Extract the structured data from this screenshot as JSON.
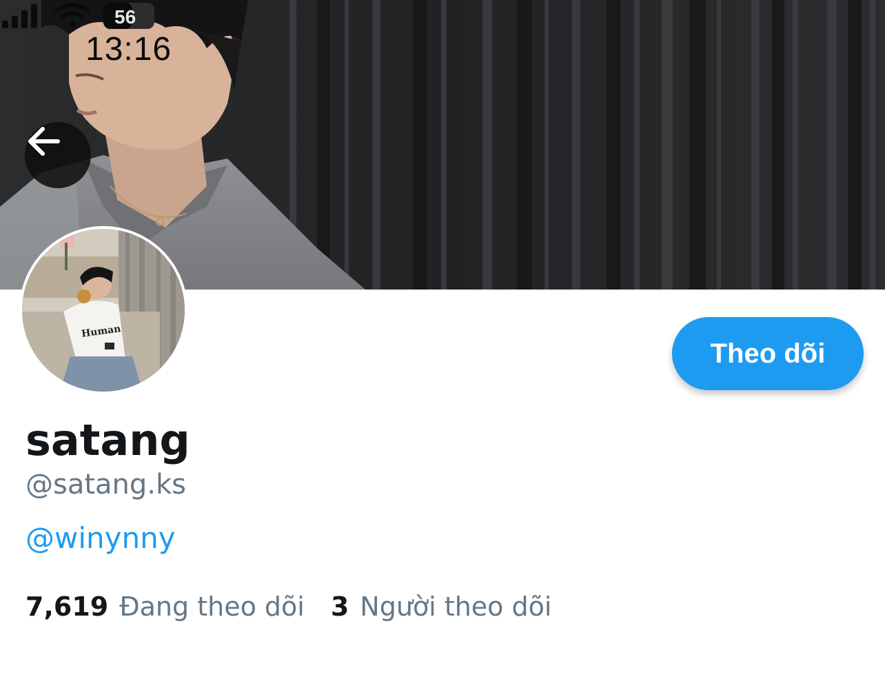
{
  "status_bar": {
    "time": "13:16",
    "battery": "56"
  },
  "header": {
    "back_icon": "arrow-left-icon"
  },
  "profile": {
    "display_name": "satang",
    "handle": "@satang.ks",
    "bio_link": "@winynny",
    "follow_label": "Theo dõi",
    "following_count": "7,619",
    "following_label": "Đang theo dõi",
    "followers_count": "3",
    "followers_label": "Người theo dõi"
  },
  "colors": {
    "accent": "#1d9bf0",
    "secondary_text": "#657786",
    "primary_text": "#14171a"
  }
}
